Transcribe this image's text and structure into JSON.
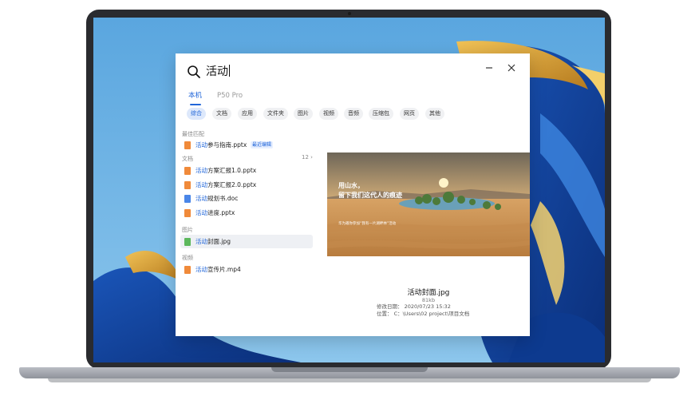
{
  "search": {
    "query": "活动"
  },
  "tabs": [
    {
      "label": "本机",
      "active": true
    },
    {
      "label": "P50 Pro",
      "active": false
    }
  ],
  "filters": [
    "综合",
    "文档",
    "应用",
    "文件夹",
    "图片",
    "视频",
    "音频",
    "压缩包",
    "网页",
    "其他"
  ],
  "sections": {
    "best_match": "最佳匹配",
    "documents": "文档",
    "documents_count": "12",
    "images": "图片",
    "videos": "视频"
  },
  "results": {
    "best": {
      "highlight": "活动",
      "rest": "参与指南.pptx",
      "badge": "最近编辑"
    },
    "docs": [
      {
        "highlight": "活动",
        "rest": "方案汇报1.0.pptx",
        "type": "ppt"
      },
      {
        "highlight": "活动",
        "rest": "方案汇报2.0.pptx",
        "type": "ppt"
      },
      {
        "highlight": "活动",
        "rest": "规划书.doc",
        "type": "doc"
      },
      {
        "highlight": "活动",
        "rest": "进度.pptx",
        "type": "ppt"
      }
    ],
    "image": {
      "highlight": "活动",
      "rest": "封面.jpg"
    },
    "video": {
      "highlight": "活动",
      "rest": "宣传片.mp4"
    }
  },
  "preview": {
    "image_text_1": "用山水，",
    "image_text_2": "留下我们这代人的痕迹",
    "image_text_3": "华为邀你参加“我有一片湖畔林”活动",
    "filename": "活动封面.jpg",
    "size": "81kb",
    "modified": "修改日期：  2020/07/23 15:32",
    "location": "位置：  C：\\Users\\02 project\\项目文档"
  },
  "colors": {
    "accent": "#2166d9",
    "ppt": "#f08a3a",
    "doc": "#4a86e8",
    "img": "#5cb85c"
  }
}
